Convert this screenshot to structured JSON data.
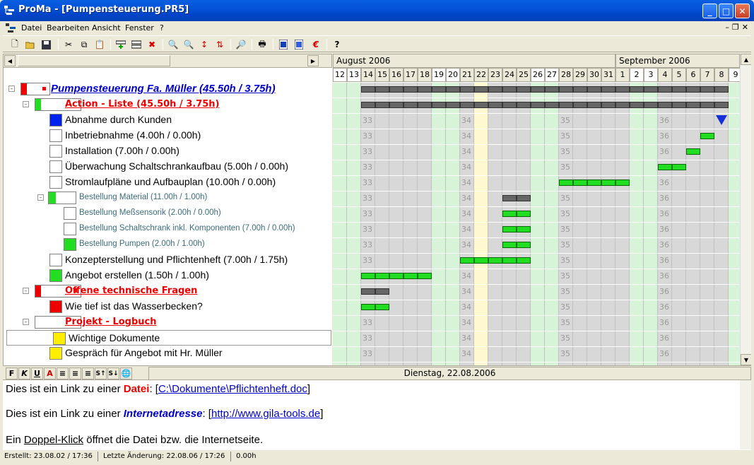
{
  "window": {
    "title": "ProMa - [Pumpensteuerung.PR5]"
  },
  "menu": {
    "items": [
      "Datei",
      "Bearbeiten",
      "Ansicht",
      "Fenster",
      "?"
    ]
  },
  "toolbar": {
    "icons": [
      "new-icon",
      "open-icon",
      "save-icon",
      "cut-icon",
      "copy-icon",
      "paste-icon",
      "add-task-icon",
      "insert-icon",
      "delete-icon",
      "zoom-in-icon",
      "zoom-out-icon",
      "sort-up-icon",
      "sort-down-icon",
      "search-icon",
      "print-icon",
      "export-icon",
      "import-icon",
      "euro-icon",
      "help-icon"
    ]
  },
  "tree": {
    "rows": [
      {
        "label": "Pumpensteuerung Fa. Müller (45.50h / 3.75h)",
        "style": "l0",
        "color": "#ee0000"
      },
      {
        "label": "Action - Liste (45.50h / 3.75h)",
        "style": "l1",
        "color": "#22dd22"
      },
      {
        "label": "Abnahme durch Kunden",
        "style": "l2",
        "color": "#0022ee"
      },
      {
        "label": "Inbetriebnahme (4.00h / 0.00h)",
        "style": "l2",
        "color": "#ffffff"
      },
      {
        "label": "Installation (7.00h / 0.00h)",
        "style": "l2",
        "color": "#ffffff"
      },
      {
        "label": "Überwachung Schaltschrankaufbau (5.00h / 0.00h)",
        "style": "l2",
        "color": "#ffffff"
      },
      {
        "label": "Stromlaufpläne und Aufbauplan (10.00h / 0.00h)",
        "style": "l2",
        "color": "#ffffff"
      },
      {
        "label": "Bestellung Material (11.00h / 1.00h)",
        "style": "sub",
        "color": "#22dd22"
      },
      {
        "label": "Bestellung Meßsensorik (2.00h / 0.00h)",
        "style": "sub",
        "color": "#ffffff"
      },
      {
        "label": "Bestellung Schaltschrank inkl. Komponenten (7.00h / 0.00h)",
        "style": "sub",
        "color": "#ffffff"
      },
      {
        "label": "Bestellung Pumpen (2.00h / 1.00h)",
        "style": "sub",
        "color": "#22dd22"
      },
      {
        "label": "Konzepterstellung und Pflichtenheft (7.00h / 1.75h)",
        "style": "l2",
        "color": "#ffffff"
      },
      {
        "label": "Angebot erstellen (1.50h / 1.00h)",
        "style": "l2",
        "color": "#22dd22"
      },
      {
        "label": "Offene technische Fragen",
        "style": "l1",
        "color": "#ee0000"
      },
      {
        "label": "Wie tief ist das Wasserbecken?",
        "style": "l2",
        "color": "#ee0000"
      },
      {
        "label": "Projekt - Logbuch",
        "style": "l1",
        "color": "#ffffff"
      },
      {
        "label": "Wichtige Dokumente",
        "style": "l2",
        "color": "#ffee00"
      },
      {
        "label": "Gespräch für Angebot mit Hr. Müller",
        "style": "l2",
        "color": "#ffee00"
      }
    ]
  },
  "gantt": {
    "months": [
      {
        "label": "August 2006"
      },
      {
        "label": "September 2006"
      }
    ],
    "days": [
      "12",
      "13",
      "14",
      "15",
      "16",
      "17",
      "18",
      "19",
      "20",
      "21",
      "22",
      "23",
      "24",
      "25",
      "26",
      "27",
      "28",
      "29",
      "30",
      "31",
      "1",
      "2",
      "3",
      "4",
      "5",
      "6",
      "7",
      "8",
      "9"
    ],
    "weekend_days": [
      "12",
      "13",
      "19",
      "20",
      "26",
      "27",
      "2",
      "3",
      "9"
    ],
    "today": "22",
    "week_numbers": [
      {
        "label": "33",
        "day": "14"
      },
      {
        "label": "34",
        "day": "21"
      },
      {
        "label": "35",
        "day": "28"
      },
      {
        "label": "36",
        "day": "4"
      }
    ],
    "bars": [
      {
        "row": 0,
        "start": "14",
        "end": "8",
        "kind": "gray"
      },
      {
        "row": 1,
        "start": "14",
        "end": "8",
        "kind": "gray"
      },
      {
        "row": 3,
        "start": "7",
        "end": "7",
        "kind": "green"
      },
      {
        "row": 4,
        "start": "6",
        "end": "6",
        "kind": "green"
      },
      {
        "row": 5,
        "start": "4",
        "end": "5",
        "kind": "green"
      },
      {
        "row": 6,
        "start": "28",
        "end": "1",
        "kind": "green"
      },
      {
        "row": 7,
        "start": "24",
        "end": "25",
        "kind": "gray"
      },
      {
        "row": 8,
        "start": "24",
        "end": "25",
        "kind": "green"
      },
      {
        "row": 9,
        "start": "24",
        "end": "25",
        "kind": "green"
      },
      {
        "row": 10,
        "start": "24",
        "end": "25",
        "kind": "green"
      },
      {
        "row": 11,
        "start": "21",
        "end": "25",
        "kind": "green"
      },
      {
        "row": 12,
        "start": "14",
        "end": "18",
        "kind": "green"
      },
      {
        "row": 13,
        "start": "14",
        "end": "15",
        "kind": "gray"
      },
      {
        "row": 14,
        "start": "14",
        "end": "15",
        "kind": "green"
      }
    ],
    "milestone": {
      "row": 2,
      "day": "8"
    }
  },
  "format_bar": {
    "buttons": [
      "F",
      "K",
      "U"
    ],
    "date": "Dienstag, 22.08.2006"
  },
  "note": {
    "line1_pre": "Dies ist ein Link zu einer ",
    "line1_word": "Datei",
    "line1_colon": ": [",
    "line1_link": "C:\\Dokumente\\Pflichtenheft.doc",
    "line1_close": "]",
    "line2_pre": "Dies ist ein Link zu einer ",
    "line2_word": "Internetadresse",
    "line2_colon": ": [",
    "line2_link": "http://www.gila-tools.de",
    "line2_close": "]",
    "line3_pre": "Ein ",
    "line3_u": "Doppel-Klick",
    "line3_post": " öffnet die Datei bzw. die Internetseite."
  },
  "status": {
    "created": "Erstellt: 23.08.02 / 17:36",
    "changed": "Letzte Änderung: 22.08.06 / 17:26",
    "hours": "0.00h"
  }
}
